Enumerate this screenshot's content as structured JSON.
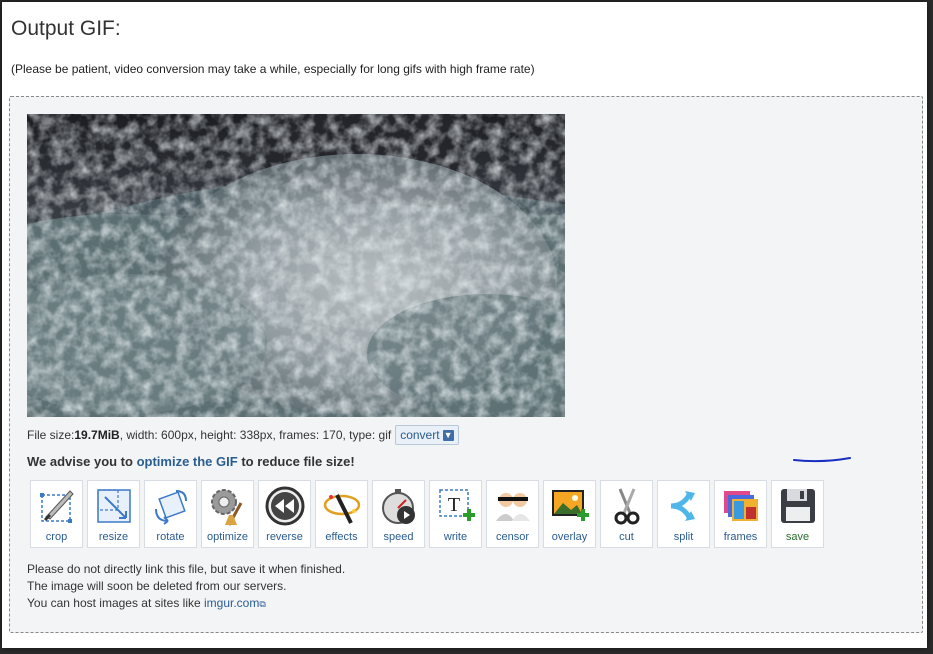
{
  "header": {
    "title": "Output GIF:",
    "subtitle": "(Please be patient, video conversion may take a while, especially for long gifs with high frame rate)"
  },
  "file_info": {
    "size_label": "File size: ",
    "size_value": "19.7MiB",
    "details": ", width: 600px, height: 338px, frames: 170, type: gif",
    "convert_label": "convert"
  },
  "advice": {
    "prefix": "We advise you to ",
    "link": "optimize the GIF",
    "suffix": " to reduce file size!"
  },
  "tools": [
    {
      "label": "crop",
      "icon": "crop-icon"
    },
    {
      "label": "resize",
      "icon": "resize-icon"
    },
    {
      "label": "rotate",
      "icon": "rotate-icon"
    },
    {
      "label": "optimize",
      "icon": "optimize-icon"
    },
    {
      "label": "reverse",
      "icon": "reverse-icon"
    },
    {
      "label": "effects",
      "icon": "effects-icon"
    },
    {
      "label": "speed",
      "icon": "speed-icon"
    },
    {
      "label": "write",
      "icon": "write-icon"
    },
    {
      "label": "censor",
      "icon": "censor-icon"
    },
    {
      "label": "overlay",
      "icon": "overlay-icon"
    },
    {
      "label": "cut",
      "icon": "cut-icon"
    },
    {
      "label": "split",
      "icon": "split-icon"
    },
    {
      "label": "frames",
      "icon": "frames-icon"
    },
    {
      "label": "save",
      "icon": "save-icon"
    }
  ],
  "notes": {
    "line1": "Please do not directly link this file, but save it when finished.",
    "line2": "The image will soon be deleted from our servers.",
    "line3_prefix": "You can host images at sites like ",
    "line3_link": "imgur.com"
  },
  "colors": {
    "link": "#2a5d8f",
    "panel_bg": "#f3f4f6",
    "save_label": "#2a6f2a",
    "annotation_underline": "#1a2fbf"
  }
}
